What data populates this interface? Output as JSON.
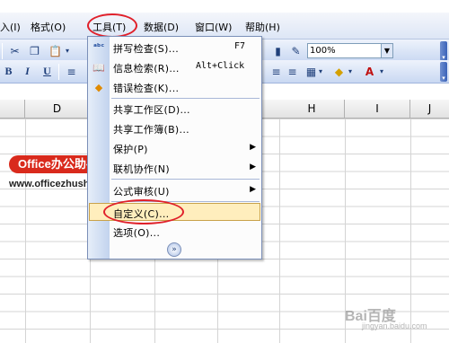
{
  "menubar": {
    "items": [
      {
        "label": "入(I)"
      },
      {
        "label": "格式(O)"
      },
      {
        "label": "工具(T)"
      },
      {
        "label": "数据(D)"
      },
      {
        "label": "窗口(W)"
      },
      {
        "label": "帮助(H)"
      }
    ]
  },
  "toolbar": {
    "zoom_value": "100%",
    "bold_label": "B",
    "italic_label": "I",
    "underline_label": "U"
  },
  "columns": [
    "D",
    "H",
    "I",
    "J"
  ],
  "tools_menu": {
    "items": [
      {
        "label": "拼写检查(S)...",
        "shortcut": "F7",
        "icon": "spellcheck-icon"
      },
      {
        "label": "信息检索(R)...",
        "shortcut": "Alt+Click",
        "icon": "research-icon"
      },
      {
        "label": "错误检查(K)...",
        "shortcut": "",
        "icon": "error-check-icon"
      },
      {
        "label": "共享工作区(D)...",
        "shortcut": ""
      },
      {
        "label": "共享工作簿(B)...",
        "shortcut": ""
      },
      {
        "label": "保护(P)",
        "shortcut": "",
        "submenu": true
      },
      {
        "label": "联机协作(N)",
        "shortcut": "",
        "submenu": true
      },
      {
        "label": "公式审核(U)",
        "shortcut": "",
        "submenu": true
      },
      {
        "label": "自定义(C)...",
        "shortcut": "",
        "highlighted": true
      },
      {
        "label": "选项(O)...",
        "shortcut": ""
      }
    ],
    "expand_icon": "chevron-double-down-icon"
  },
  "watermark": {
    "logo_text": "Office办公助手",
    "url_text": "www.officezhushou.com",
    "baidu_text": "Bai百度",
    "baidu_sub": "jingyan.baidu.com"
  },
  "colors": {
    "highlight": "#ffeebd",
    "annotation_red": "#e0202a",
    "logo_red": "#d92a1c"
  }
}
